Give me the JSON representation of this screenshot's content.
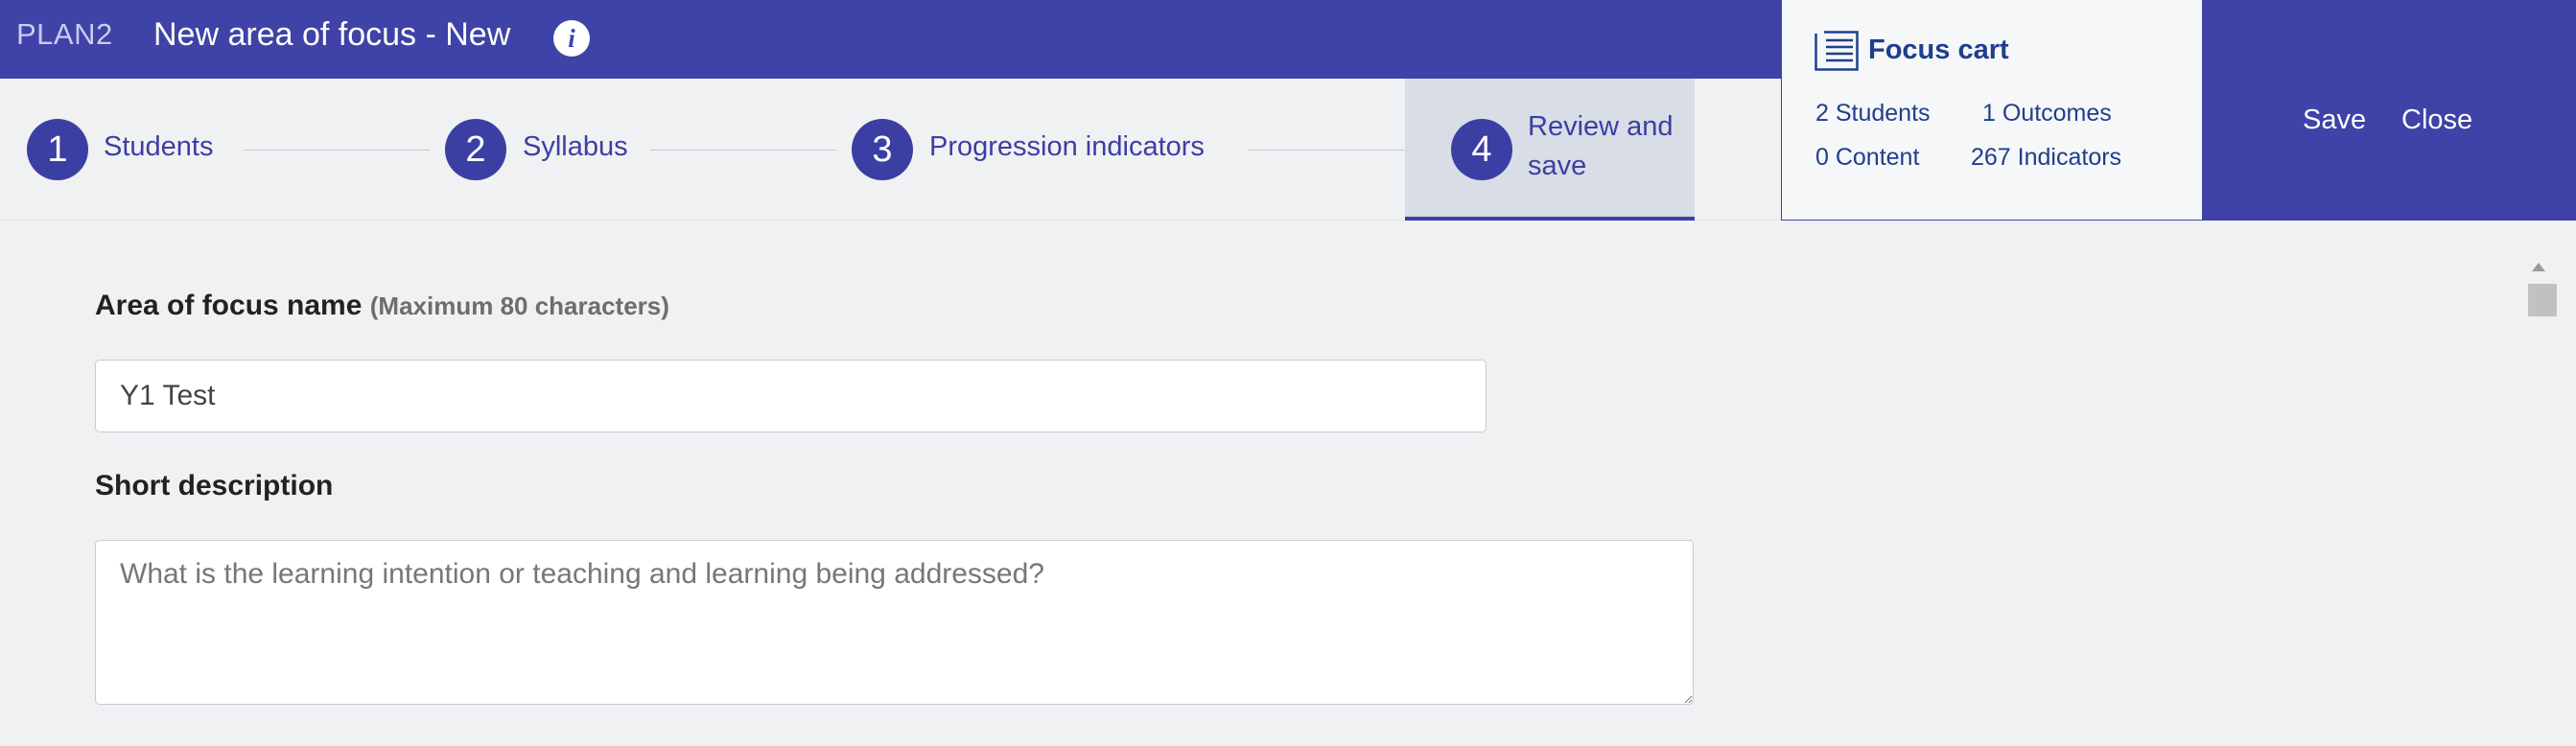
{
  "header": {
    "brand": "PLAN2",
    "title": "New area of focus - New",
    "info_icon": "info-icon",
    "save_label": "Save",
    "close_label": "Close",
    "accent_color": "#3f42a6"
  },
  "steps": [
    {
      "number": "1",
      "label": "Students"
    },
    {
      "number": "2",
      "label": "Syllabus"
    },
    {
      "number": "3",
      "label": "Progression indicators"
    },
    {
      "number": "4",
      "label": "Review and save",
      "active": true
    }
  ],
  "cart": {
    "icon": "list-icon",
    "title": "Focus cart",
    "students": "2 Students",
    "outcomes": "1 Outcomes",
    "content": "0 Content",
    "indicators": "267 Indicators"
  },
  "form": {
    "name_label": "Area of focus name",
    "name_hint": "(Maximum 80 characters)",
    "name_value": "Y1 Test",
    "desc_label": "Short description",
    "desc_placeholder": "What is the learning intention or teaching and learning being addressed?"
  }
}
